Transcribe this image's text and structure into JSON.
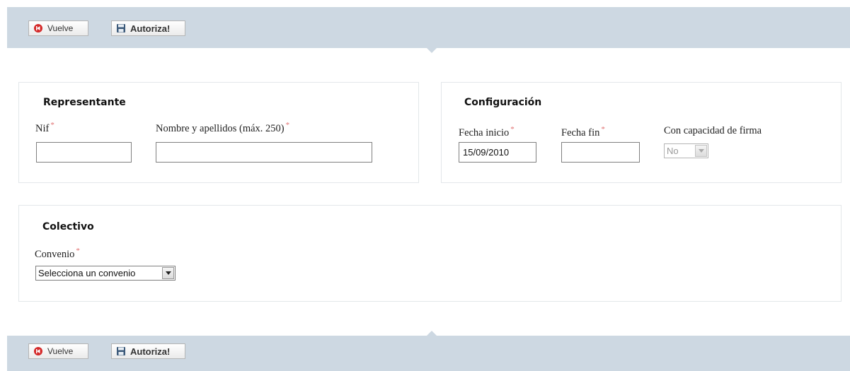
{
  "toolbar": {
    "back_label": "Vuelve",
    "authorize_label": "Autoriza!"
  },
  "representante": {
    "title": "Representante",
    "nif_label": "Nif",
    "nif_value": "",
    "name_label": "Nombre y apellidos (máx. 250)",
    "name_value": ""
  },
  "configuracion": {
    "title": "Configuración",
    "start_label": "Fecha inicio",
    "start_value": "15/09/2010",
    "end_label": "Fecha fin",
    "end_value": "",
    "sign_label": "Con capacidad de firma",
    "sign_value": "No"
  },
  "colectivo": {
    "title": "Colectivo",
    "convenio_label": "Convenio",
    "convenio_value": "Selecciona un convenio"
  },
  "required_mark": "*",
  "colors": {
    "toolbar_bg": "#cdd8e2",
    "required": "#e07070"
  },
  "icons": {
    "back": "back-arrow-icon",
    "authorize": "floppy-disk-icon"
  }
}
